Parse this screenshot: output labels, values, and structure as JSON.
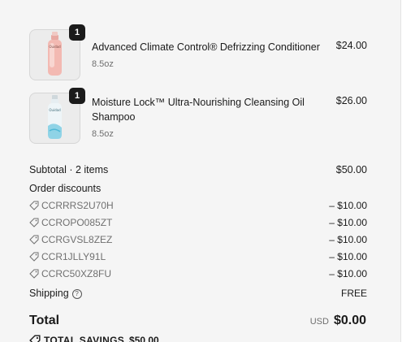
{
  "items": [
    {
      "quantity": "1",
      "name": "Advanced Climate Control® Defrizzing Conditioner",
      "size": "8.5oz",
      "price": "$24.00",
      "image_icon": "conditioner-bottle-pink"
    },
    {
      "quantity": "1",
      "name": "Moisture Lock™ Ultra-Nourishing Cleansing Oil Shampoo",
      "size": "8.5oz",
      "price": "$26.00",
      "image_icon": "shampoo-bottle-blue"
    }
  ],
  "subtotal": {
    "label": "Subtotal · 2 items",
    "value": "$50.00"
  },
  "order_discounts": {
    "label": "Order discounts",
    "codes": [
      {
        "code": "CCRRRS2U70H",
        "amount": "– $10.00"
      },
      {
        "code": "CCROPO085ZT",
        "amount": "– $10.00"
      },
      {
        "code": "CCRGVSL8ZEZ",
        "amount": "– $10.00"
      },
      {
        "code": "CCR1JLLY91L",
        "amount": "– $10.00"
      },
      {
        "code": "CCRC50XZ8FU",
        "amount": "– $10.00"
      }
    ]
  },
  "shipping": {
    "label": "Shipping",
    "value": "FREE"
  },
  "total": {
    "label": "Total",
    "currency": "USD",
    "value": "$0.00"
  },
  "savings": {
    "label": "TOTAL SAVINGS",
    "value": "$50.00"
  },
  "colors": {
    "panel_bg": "#f5f5f5",
    "badge_bg": "#1b1b1b",
    "muted_text": "#707070"
  }
}
